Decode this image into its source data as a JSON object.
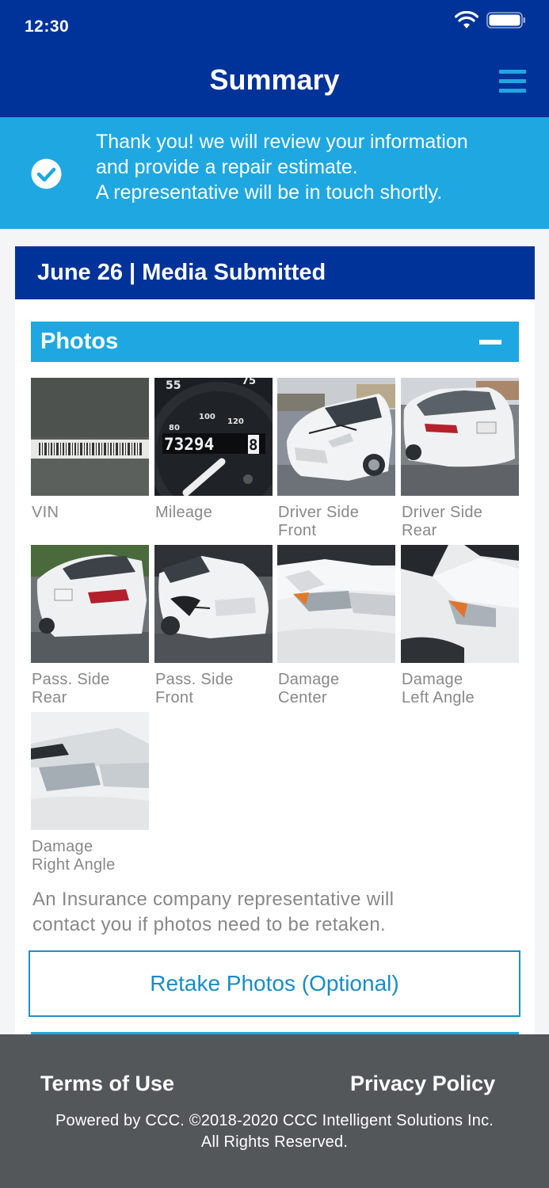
{
  "status_bar": {
    "time": "12:30"
  },
  "nav": {
    "title": "Summary"
  },
  "banner": {
    "lines": [
      "Thank you! we will review your information",
      "and provide a repair estimate.",
      "A representative will be in touch shortly."
    ]
  },
  "card": {
    "header": "June 26  |  Media Submitted",
    "section_title": "Photos",
    "photos": [
      {
        "caption_lines": [
          "VIN"
        ]
      },
      {
        "caption_lines": [
          "Mileage"
        ]
      },
      {
        "caption_lines": [
          "Driver Side",
          "Front"
        ]
      },
      {
        "caption_lines": [
          "Driver Side",
          "Rear"
        ]
      },
      {
        "caption_lines": [
          "Pass. Side",
          "Rear"
        ]
      },
      {
        "caption_lines": [
          "Pass. Side",
          "Front"
        ]
      },
      {
        "caption_lines": [
          "Damage",
          "Center"
        ]
      },
      {
        "caption_lines": [
          "Damage",
          "Left Angle"
        ]
      },
      {
        "caption_lines": [
          "Damage",
          "Right Angle"
        ]
      }
    ],
    "odometer": {
      "reading": "73294",
      "reading_end": "8",
      "speed_marks": [
        "55",
        "75",
        "80",
        "100",
        "120"
      ]
    },
    "note_lines": [
      "An Insurance company representative will",
      "contact you if photos need to be retaken."
    ],
    "retake_button": "Retake Photos (Optional)"
  },
  "footer": {
    "terms": "Terms of Use",
    "privacy": "Privacy Policy",
    "copyright_lines": [
      "Powered by CCC. ©2018-2020 CCC Intelligent Solutions Inc.",
      "All Rights Reserved."
    ]
  },
  "colors": {
    "nav_blue": "#003399",
    "accent_blue": "#1ea7e1",
    "footer_gray": "#54575a"
  }
}
